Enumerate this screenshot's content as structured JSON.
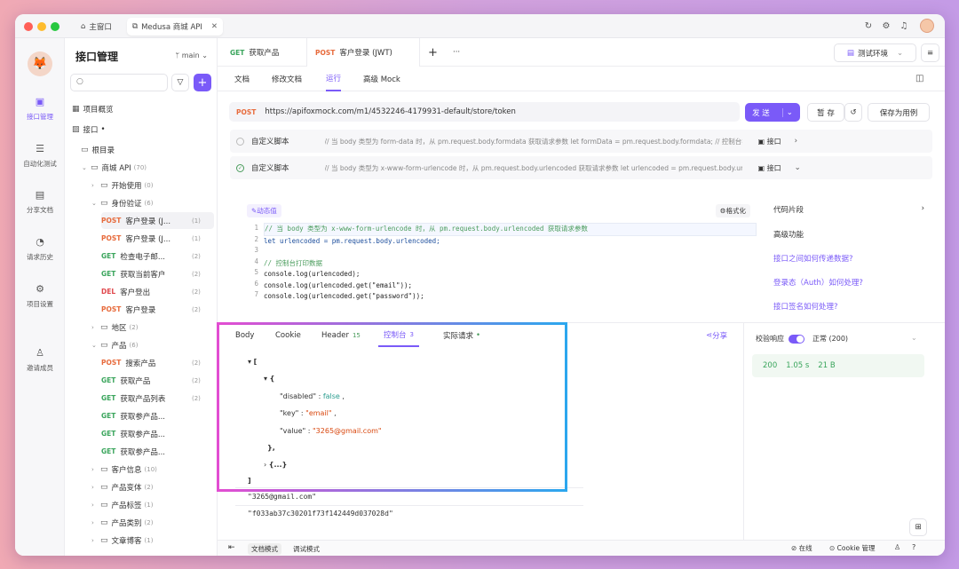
{
  "window": {
    "tab_home": "主窗口",
    "tab_project": "Medusa 商城 API"
  },
  "rail": [
    "接口管理",
    "自动化测试",
    "分享文档",
    "请求历史",
    "项目设置",
    "邀请成员"
  ],
  "tree": {
    "title": "接口管理",
    "branch": "main",
    "overview": "项目概览",
    "api_root": "接口",
    "nodes": [
      {
        "label": "根目录",
        "type": "folder",
        "indent": 0
      },
      {
        "label": "商城 API",
        "count": "(70)",
        "type": "folder",
        "indent": 1,
        "open": true
      },
      {
        "label": "开始使用",
        "count": "(0)",
        "type": "folder",
        "indent": 2
      },
      {
        "label": "身份验证",
        "count": "(6)",
        "type": "folder",
        "indent": 2,
        "open": true
      },
      {
        "method": "POST",
        "label": "客户登录 (J...",
        "count": "(1)",
        "indent": 3,
        "selected": true
      },
      {
        "method": "POST",
        "label": "客户登录 (J...",
        "count": "(1)",
        "indent": 3
      },
      {
        "method": "GET",
        "label": "检查电子邮...",
        "count": "(2)",
        "indent": 3
      },
      {
        "method": "GET",
        "label": "获取当前客户",
        "count": "(2)",
        "indent": 3
      },
      {
        "method": "DEL",
        "label": "客户登出",
        "count": "(2)",
        "indent": 3
      },
      {
        "method": "POST",
        "label": "客户登录",
        "count": "(2)",
        "indent": 3
      },
      {
        "label": "地区",
        "count": "(2)",
        "type": "folder",
        "indent": 2
      },
      {
        "label": "产品",
        "count": "(6)",
        "type": "folder",
        "indent": 2,
        "open": true
      },
      {
        "method": "POST",
        "label": "搜索产品",
        "count": "(2)",
        "indent": 3
      },
      {
        "method": "GET",
        "label": "获取产品",
        "count": "(2)",
        "indent": 3
      },
      {
        "method": "GET",
        "label": "获取产品列表",
        "count": "(2)",
        "indent": 3
      },
      {
        "method": "GET",
        "label": "获取参产品...",
        "count": "",
        "indent": 3
      },
      {
        "method": "GET",
        "label": "获取参产品...",
        "count": "",
        "indent": 3
      },
      {
        "method": "GET",
        "label": "获取参产品...",
        "count": "",
        "indent": 3
      },
      {
        "label": "客户信息",
        "count": "(10)",
        "type": "folder",
        "indent": 2
      },
      {
        "label": "产品变体",
        "count": "(2)",
        "type": "folder",
        "indent": 2
      },
      {
        "label": "产品标签",
        "count": "(1)",
        "type": "folder",
        "indent": 2
      },
      {
        "label": "产品类别",
        "count": "(2)",
        "type": "folder",
        "indent": 2
      },
      {
        "label": "文章博客",
        "count": "(1)",
        "type": "folder",
        "indent": 2
      }
    ]
  },
  "tabs": {
    "t1_method": "GET",
    "t1_label": "获取产品",
    "t2_method": "POST",
    "t2_label": "客户登录 (JWT)",
    "env": "测试环境"
  },
  "subtabs": [
    "文档",
    "修改文档",
    "运行",
    "高级 Mock"
  ],
  "request": {
    "method": "POST",
    "url": "https://apifoxmock.com/m1/4532246-4179931-default/store/token",
    "send": "发 送",
    "save_tmp": "暂 存",
    "save_case": "保存为用例"
  },
  "scripts": [
    {
      "label": "自定义脚本",
      "desc": "// 当 body 类型为 form-data 时，从 pm.request.body.formdata 获取请求参数 let formData = pm.request.body.formdata; // 控制台打...",
      "tag": "接口"
    },
    {
      "label": "自定义脚本",
      "desc": "// 当 body 类型为 x-www-form-urlencode 时，从 pm.request.body.urlencoded 获取请求参数 let urlencoded = pm.request.body.urlen...",
      "tag": "接口"
    }
  ],
  "editor": {
    "dyn": "动态值",
    "fmt": "格式化",
    "lines": [
      "// 当 body 类型为 x-www-form-urlencode 时，从 pm.request.body.urlencoded 获取请求参数",
      "let urlencoded = pm.request.body.urlencoded;",
      "",
      "// 控制台打印数据",
      "console.log(urlencoded);",
      "console.log(urlencoded.get(\"email\"));",
      "console.log(urlencoded.get(\"password\"));"
    ]
  },
  "snippets": {
    "title": "代码片段",
    "adv": "高级功能",
    "links": [
      "接口之间如何传递数据?",
      "登录态（Auth）如何处理?",
      "接口签名如何处理?"
    ]
  },
  "btabs": {
    "body": "Body",
    "cookie": "Cookie",
    "header": "Header",
    "header_count": "15",
    "console": "控制台",
    "console_count": "3",
    "actual": "实际请求",
    "share": "分享"
  },
  "console_out": {
    "k1": "\"disabled\"",
    "v1": "false",
    "k2": "\"key\"",
    "v2": "\"email\"",
    "k3": "\"value\"",
    "v3": "\"3265@gmail.com\"",
    "collapsed": "{...}",
    "log1": "\"3265@gmail.com\"",
    "log2": "\"f033ab37c30201f73f142449d037028d\""
  },
  "response": {
    "validate": "校验响应",
    "status_label": "正常 (200)",
    "code": "200",
    "time": "1.05 s",
    "size": "21 B"
  },
  "status": {
    "doc_mode": "文档模式",
    "debug_mode": "调试模式",
    "online": "在线",
    "cookie": "Cookie 管理"
  }
}
